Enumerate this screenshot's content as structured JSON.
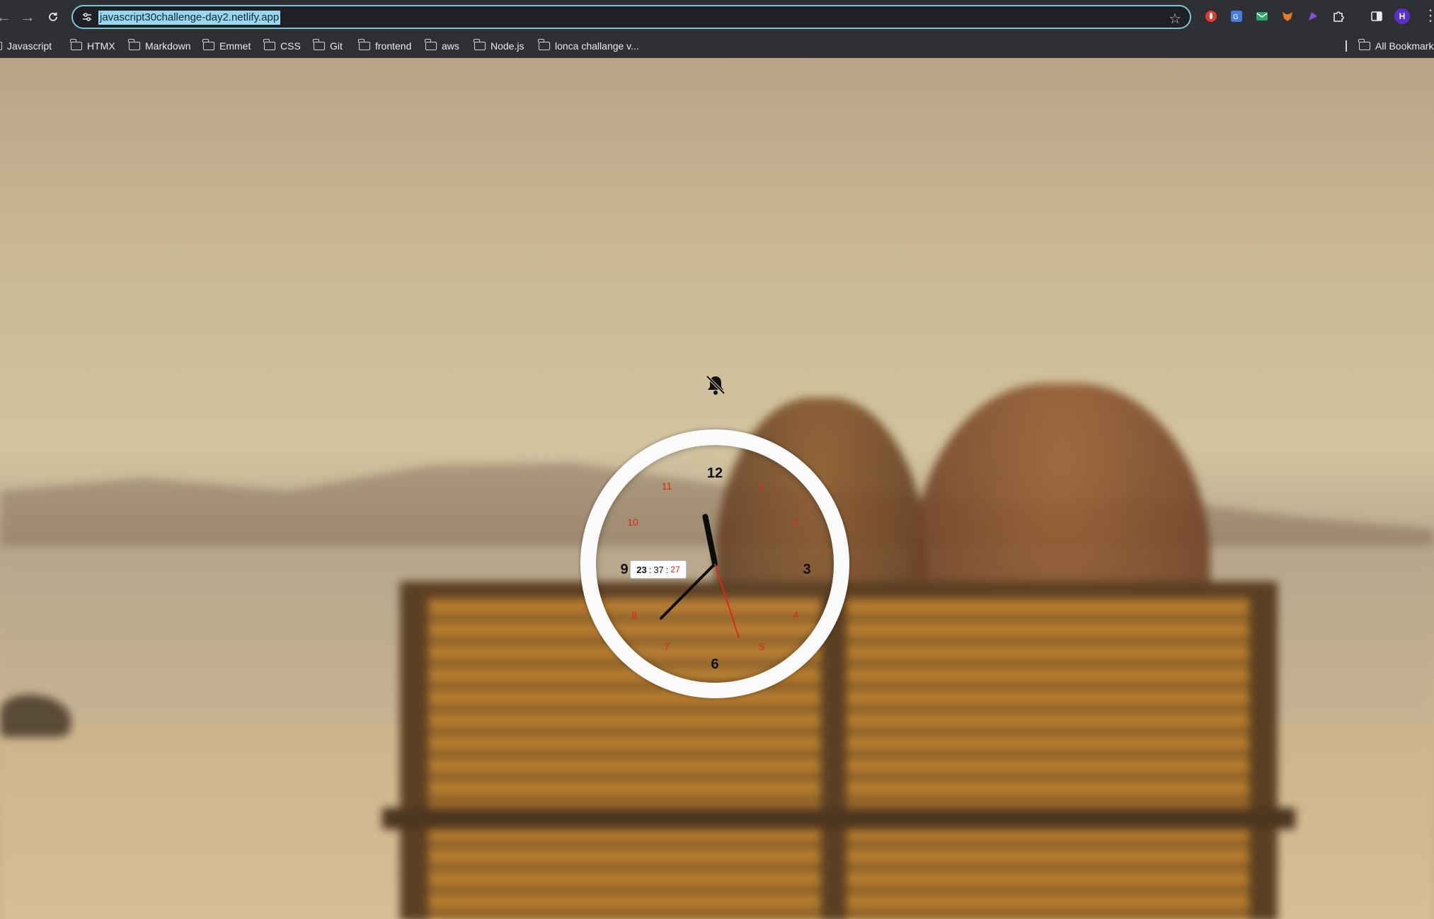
{
  "browser": {
    "url": "javascript30challenge-day2.netlify.app",
    "avatar_initial": "H",
    "extensions": [
      {
        "name": "red-extension-icon",
        "color": "#e33b2e"
      },
      {
        "name": "translate-extension-icon",
        "color": "#4a7be0"
      },
      {
        "name": "mail-extension-icon",
        "color": "#2fa56a"
      },
      {
        "name": "fox-extension-icon",
        "color": "#e57b2a"
      },
      {
        "name": "purple-extension-icon",
        "color": "#8a4fd6"
      }
    ]
  },
  "bookmarks": {
    "items": [
      "Javascript",
      "HTMX",
      "Markdown",
      "Emmet",
      "CSS",
      "Git",
      "frontend",
      "aws",
      "Node.js",
      "lonca challange v..."
    ],
    "all_label": "All Bookmarks"
  },
  "clock": {
    "numbers_major": [
      "12",
      "3",
      "6",
      "9"
    ],
    "numbers_minor": [
      "1",
      "2",
      "4",
      "5",
      "7",
      "8",
      "10",
      "11"
    ],
    "hours": "23",
    "minutes": "37",
    "seconds": "27",
    "separator": ":",
    "accent_color": "#e0271b",
    "time_value": {
      "hour": 23,
      "minute": 37,
      "second": 27
    }
  }
}
